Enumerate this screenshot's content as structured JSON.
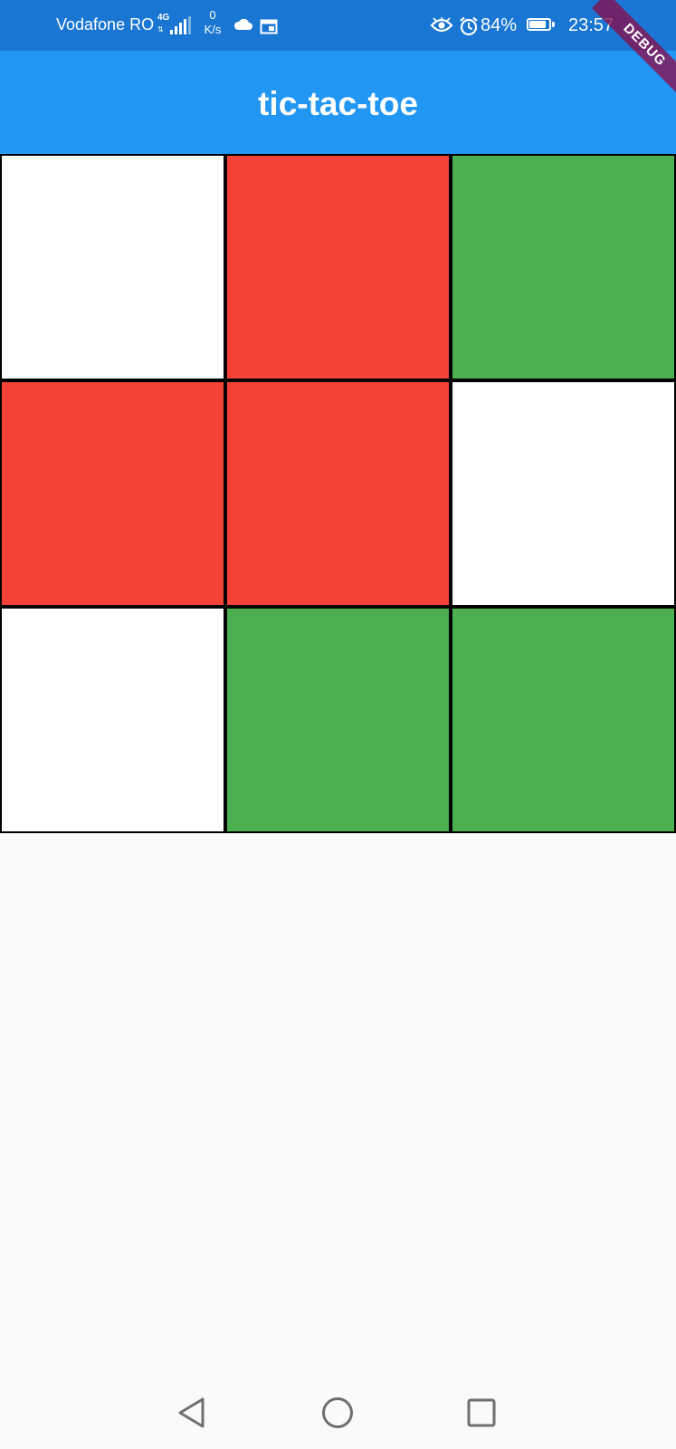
{
  "status_bar": {
    "carrier": "Vodafone RO",
    "network_type": "4G",
    "net_speed_value": "0",
    "net_speed_unit": "K/s",
    "battery_percent": "84%",
    "battery_level": 0.84,
    "time": "23:57",
    "icons": [
      "signal-icon",
      "cloud-icon",
      "calendar-icon",
      "eye-icon",
      "alarm-icon",
      "battery-icon"
    ]
  },
  "debug_banner": {
    "label": "DEBUG",
    "color": "#880e4f"
  },
  "app_bar": {
    "title": "tic-tac-toe",
    "color": "#2196f3"
  },
  "board": {
    "colors": {
      "empty": "#ffffff",
      "red": "#f44336",
      "green": "#4caf50"
    },
    "cells": [
      {
        "state": "empty",
        "color": "#ffffff"
      },
      {
        "state": "red",
        "color": "#f44336"
      },
      {
        "state": "green",
        "color": "#4caf50"
      },
      {
        "state": "red",
        "color": "#f44336"
      },
      {
        "state": "red",
        "color": "#f44336"
      },
      {
        "state": "empty",
        "color": "#ffffff"
      },
      {
        "state": "empty",
        "color": "#ffffff"
      },
      {
        "state": "green",
        "color": "#4caf50"
      },
      {
        "state": "green",
        "color": "#4caf50"
      }
    ]
  },
  "nav_bar": {
    "buttons": [
      "back-icon",
      "home-icon",
      "recent-apps-icon"
    ]
  }
}
